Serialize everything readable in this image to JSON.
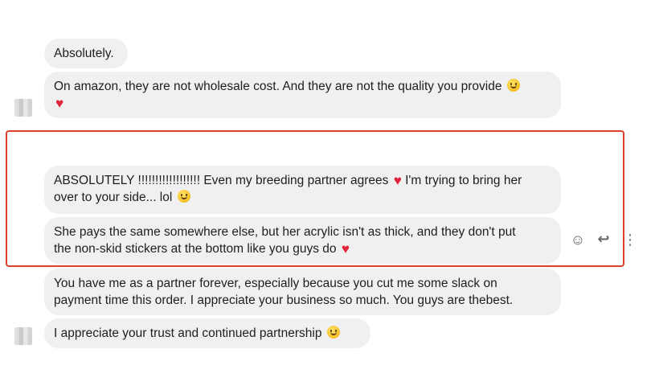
{
  "conversation": {
    "messages": [
      {
        "id": "m1",
        "text": "Absolutely.",
        "emoji": []
      },
      {
        "id": "m2",
        "text": "On amazon, they are not wholesale cost. And they are not the quality you provide",
        "emoji": [
          "smile",
          "heart"
        ]
      },
      {
        "id": "m3_line1",
        "text": "ABSOLUTELY !!!!!!!!!!!!!!!!!! Even my breeding partner agrees",
        "text_b": "I'm trying to bring her",
        "text_c": "over to your side... lol"
      },
      {
        "id": "m4_line1",
        "text": "She pays the same somewhere else, but her acrylic isn't as thick, and they don't put",
        "text_b": "the non-skid stickers at the bottom like you guys do"
      },
      {
        "id": "m5_line1",
        "text": "You have me as a partner forever, especially because you cut me some slack on",
        "text_b": "payment time this order. I appreciate your business so much. You guys are thebest."
      },
      {
        "id": "m6",
        "text": "I appreciate your trust and continued partnership"
      }
    ]
  },
  "actions": {
    "react_icon": "smiley-icon",
    "reply_icon": "reply-icon",
    "more_icon": "more-icon",
    "react_glyph": "☺",
    "reply_glyph": "↩",
    "more_glyph": "⋮"
  },
  "colors": {
    "bubble_bg": "#f0f0f0",
    "highlight_border": "#d9412c",
    "heart": "#e0243a"
  }
}
